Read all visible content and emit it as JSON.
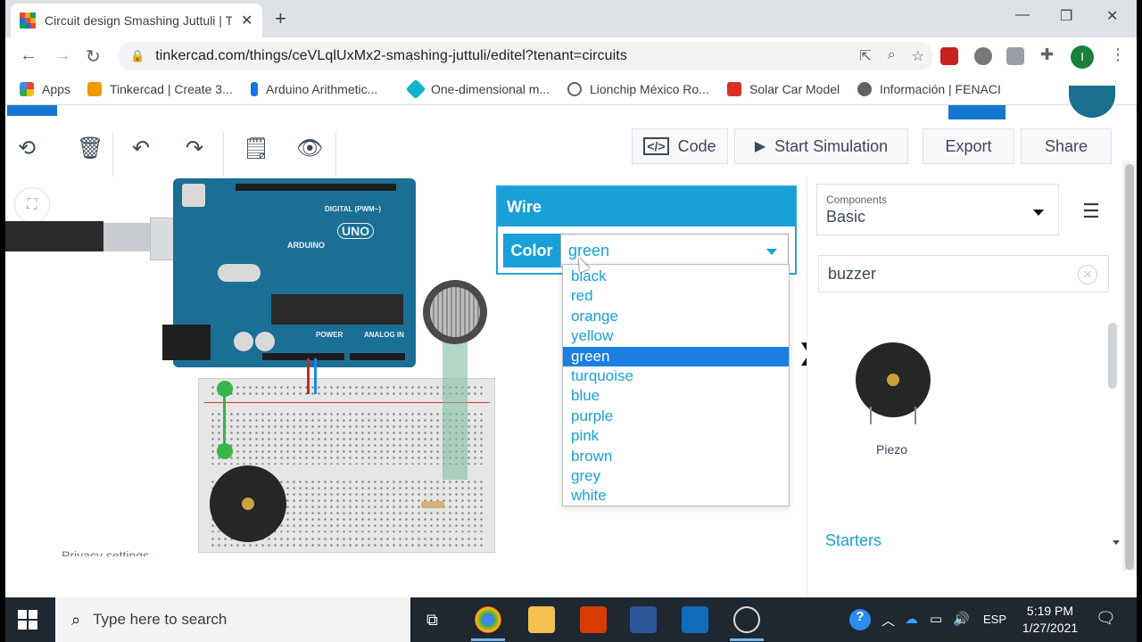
{
  "browser": {
    "tab_title": "Circuit design Smashing Juttuli | T",
    "url": "tinkercad.com/things/ceVLqlUxMx2-smashing-juttuli/editel?tenant=circuits",
    "profile_initial": "I",
    "bookmarks": [
      {
        "label": "Apps",
        "color": "#ea4335"
      },
      {
        "label": "Tinkercad | Create 3...",
        "color": "#f29900"
      },
      {
        "label": "Arduino Arithmetic...",
        "color": "#1a73e8"
      },
      {
        "label": "One-dimensional m...",
        "color": "#12b5cb"
      },
      {
        "label": "Lionchip México Ro...",
        "color": "#5f6368"
      },
      {
        "label": "Solar Car Model",
        "color": "#d93025"
      },
      {
        "label": "Información | FENACI",
        "color": "#5f6368"
      }
    ],
    "bookmarks_overflow": "»"
  },
  "toolbar": {
    "code_label": "Code",
    "start_sim_label": "Start Simulation",
    "export_label": "Export",
    "share_label": "Share"
  },
  "canvas": {
    "privacy_label": "Privacy settings",
    "arduino_labels": {
      "digital": "DIGITAL (PWM~)",
      "brand": "ARDUINO",
      "model": "UNO",
      "power": "POWER",
      "analog": "ANALOG IN"
    }
  },
  "wire_panel": {
    "title": "Wire",
    "color_label": "Color",
    "selected_color": "green",
    "options": [
      "black",
      "red",
      "orange",
      "yellow",
      "green",
      "turquoise",
      "blue",
      "purple",
      "pink",
      "brown",
      "grey",
      "white"
    ],
    "highlighted_index": 4
  },
  "components": {
    "small_label": "Components",
    "category": "Basic",
    "search_value": "buzzer",
    "results": [
      {
        "label": "Piezo"
      }
    ],
    "starters_label": "Starters"
  },
  "taskbar": {
    "search_placeholder": "Type here to search",
    "language": "ESP",
    "time": "5:19 PM",
    "date": "1/27/2021"
  },
  "colors": {
    "accent": "#19a0d9",
    "highlight": "#1a7fe0",
    "arduino": "#1b6f95"
  }
}
